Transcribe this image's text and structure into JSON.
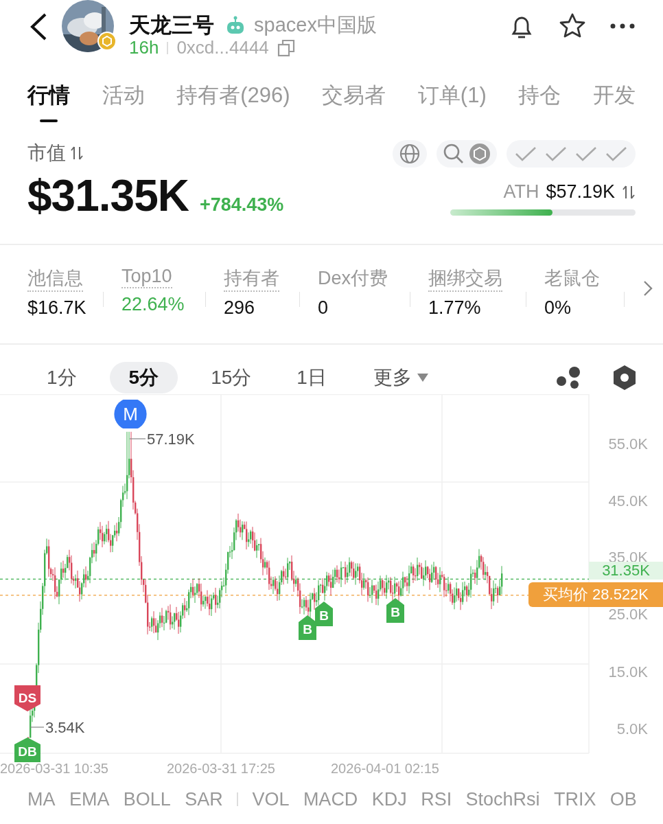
{
  "header": {
    "name": "天龙三号",
    "community": "spacex中国版",
    "age": "16h",
    "address": "0xcd...4444"
  },
  "tabs": [
    {
      "label": "行情",
      "selected": true
    },
    {
      "label": "活动",
      "selected": false
    },
    {
      "label": "持有者(296)",
      "selected": false
    },
    {
      "label": "交易者",
      "selected": false
    },
    {
      "label": "订单(1)",
      "selected": false
    },
    {
      "label": "持仓",
      "selected": false
    },
    {
      "label": "开发",
      "selected": false
    }
  ],
  "market_cap": {
    "label": "市值",
    "value": "$31.35K",
    "change": "+784.43%",
    "ath_label": "ATH",
    "ath_value": "$57.19K",
    "ath_progress": {
      "level": 0.55
    }
  },
  "stats": [
    {
      "label": "池信息",
      "value": "$16.7K",
      "dotted": true,
      "positive": false
    },
    {
      "label": "Top10",
      "value": "22.64%",
      "dotted": true,
      "positive": true
    },
    {
      "label": "持有者",
      "value": "296",
      "dotted": true,
      "positive": false
    },
    {
      "label": "Dex付费",
      "value": "0",
      "dotted": false,
      "positive": false
    },
    {
      "label": "捆绑交易",
      "value": "1.77%",
      "dotted": true,
      "positive": false
    },
    {
      "label": "老鼠仓",
      "value": "0%",
      "dotted": false,
      "positive": false
    }
  ],
  "timeframes": [
    {
      "label": "1分",
      "selected": false
    },
    {
      "label": "5分",
      "selected": true
    },
    {
      "label": "15分",
      "selected": false
    },
    {
      "label": "1日",
      "selected": false
    }
  ],
  "more": "更多",
  "chart": {
    "y_ticks": [
      "55.0K",
      "45.0K",
      "35.0K",
      "25.0K",
      "15.0K",
      "5.0K"
    ],
    "x_ticks": [
      "2026-03-31 10:35",
      "2026-03-31 17:25",
      "2026-04-01 02:15"
    ],
    "high_label": "57.19K",
    "low_label": "3.54K",
    "markers": [
      {
        "kind": "mention",
        "text": "M"
      },
      {
        "kind": "dev_sell",
        "text": "DS"
      },
      {
        "kind": "dev_buy",
        "text": "DB"
      },
      {
        "kind": "buy",
        "text": "B"
      },
      {
        "kind": "buy",
        "text": "B"
      },
      {
        "kind": "buy",
        "text": "B"
      }
    ],
    "last_price": "31.35K",
    "avg_buy_tag": "买均价 28.522K"
  },
  "indicators": {
    "overlays": [
      "MA",
      "EMA",
      "BOLL",
      "SAR"
    ],
    "oscillators": [
      "VOL",
      "MACD",
      "KDJ",
      "RSI",
      "StochRsi",
      "TRIX",
      "OB"
    ]
  }
}
